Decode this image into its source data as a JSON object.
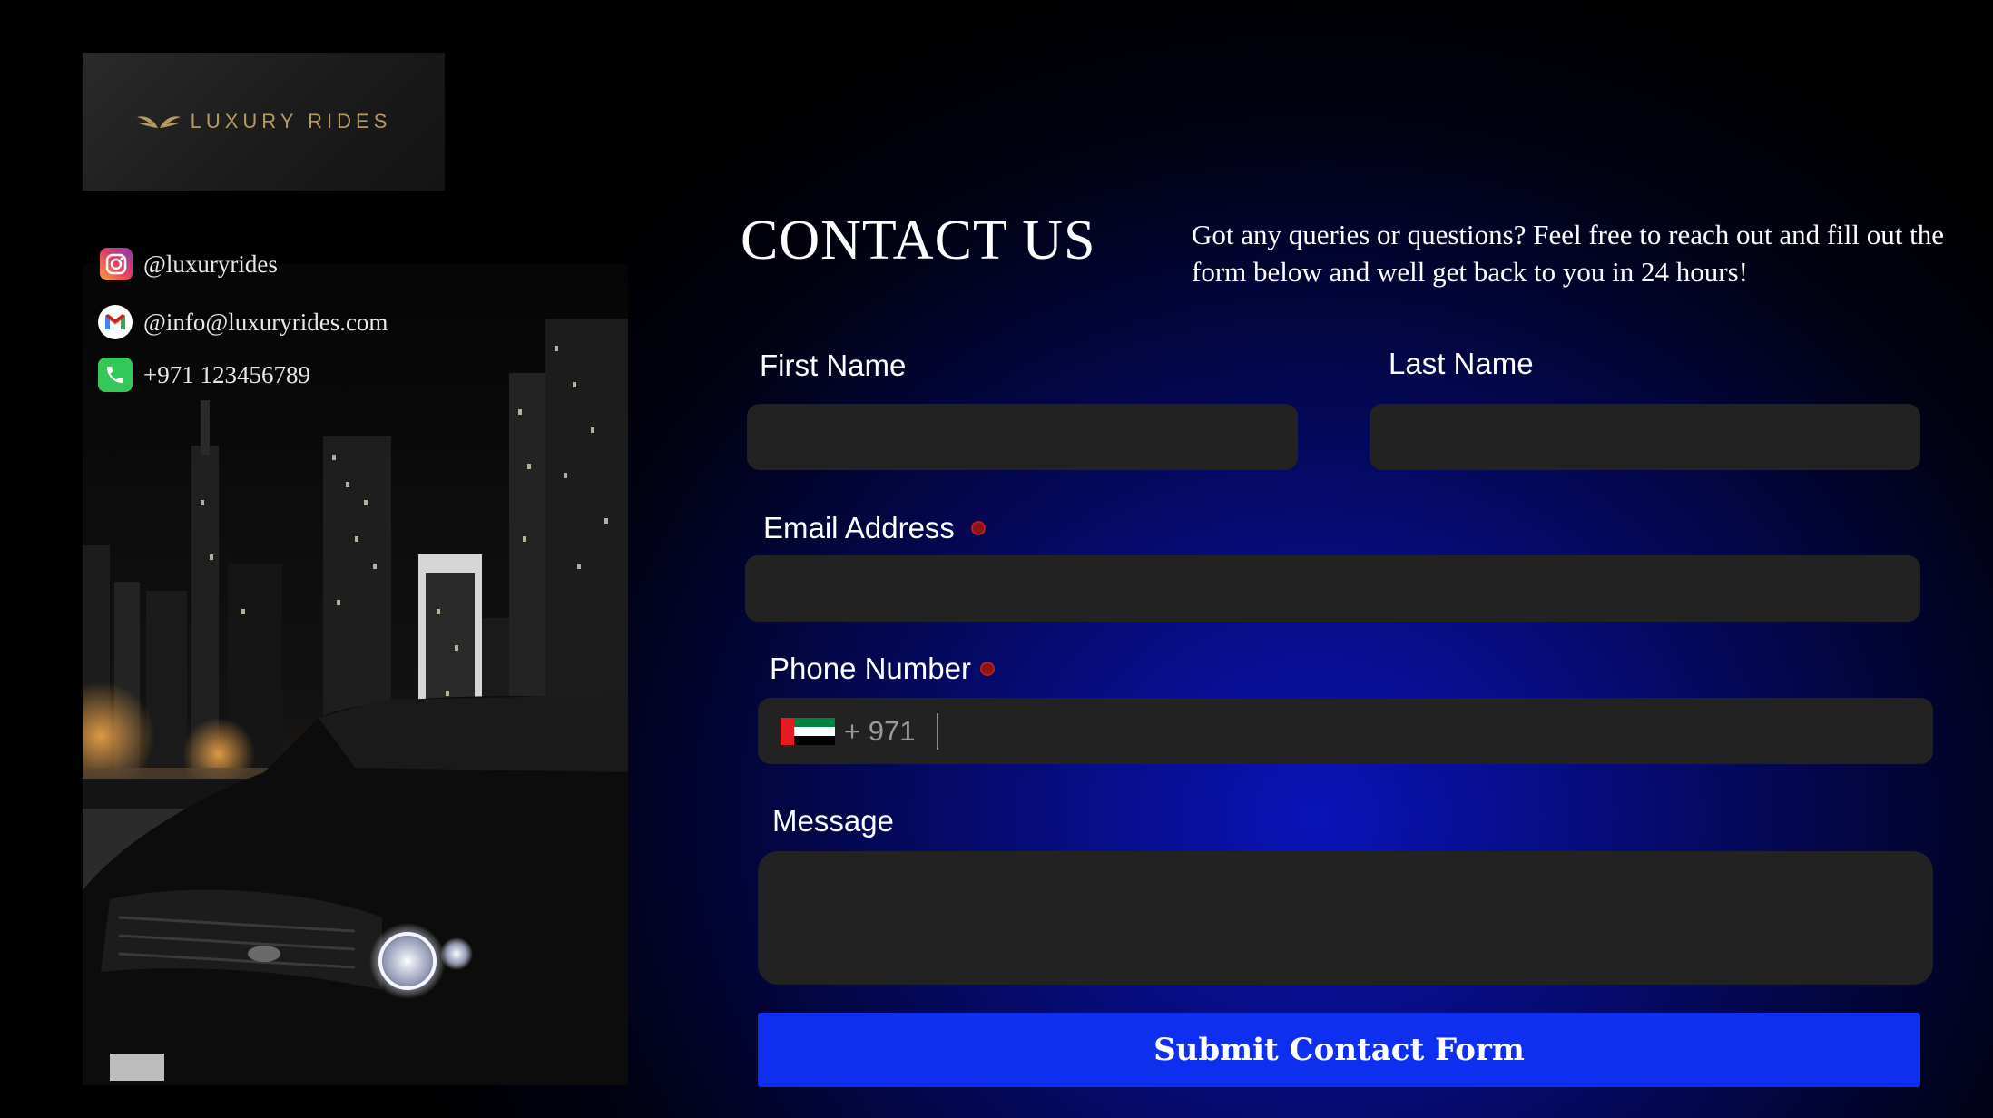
{
  "brand": {
    "name": "LUXURY RIDES",
    "accent_color": "#b79a5f"
  },
  "contacts": [
    {
      "icon": "instagram-icon",
      "text": "@luxuryrides"
    },
    {
      "icon": "gmail-icon",
      "text": "@info@luxuryrides.com"
    },
    {
      "icon": "phone-icon",
      "text": "+971 123456789"
    }
  ],
  "contact": {
    "title": "CONTACT US",
    "intro": "Got any queries or questions? Feel free to reach out and fill out the form below and well get back to you in 24 hours!"
  },
  "form": {
    "first_name": {
      "label": "First Name",
      "value": ""
    },
    "last_name": {
      "label": "Last Name",
      "value": ""
    },
    "email": {
      "label": "Email Address",
      "value": "",
      "required": true
    },
    "phone": {
      "label": "Phone Number",
      "country_code": "+ 971",
      "country": "UAE",
      "value": "",
      "required": true
    },
    "message": {
      "label": "Message",
      "value": ""
    },
    "submit_label": "Submit Contact Form",
    "submit_color": "#0f2ff0"
  }
}
